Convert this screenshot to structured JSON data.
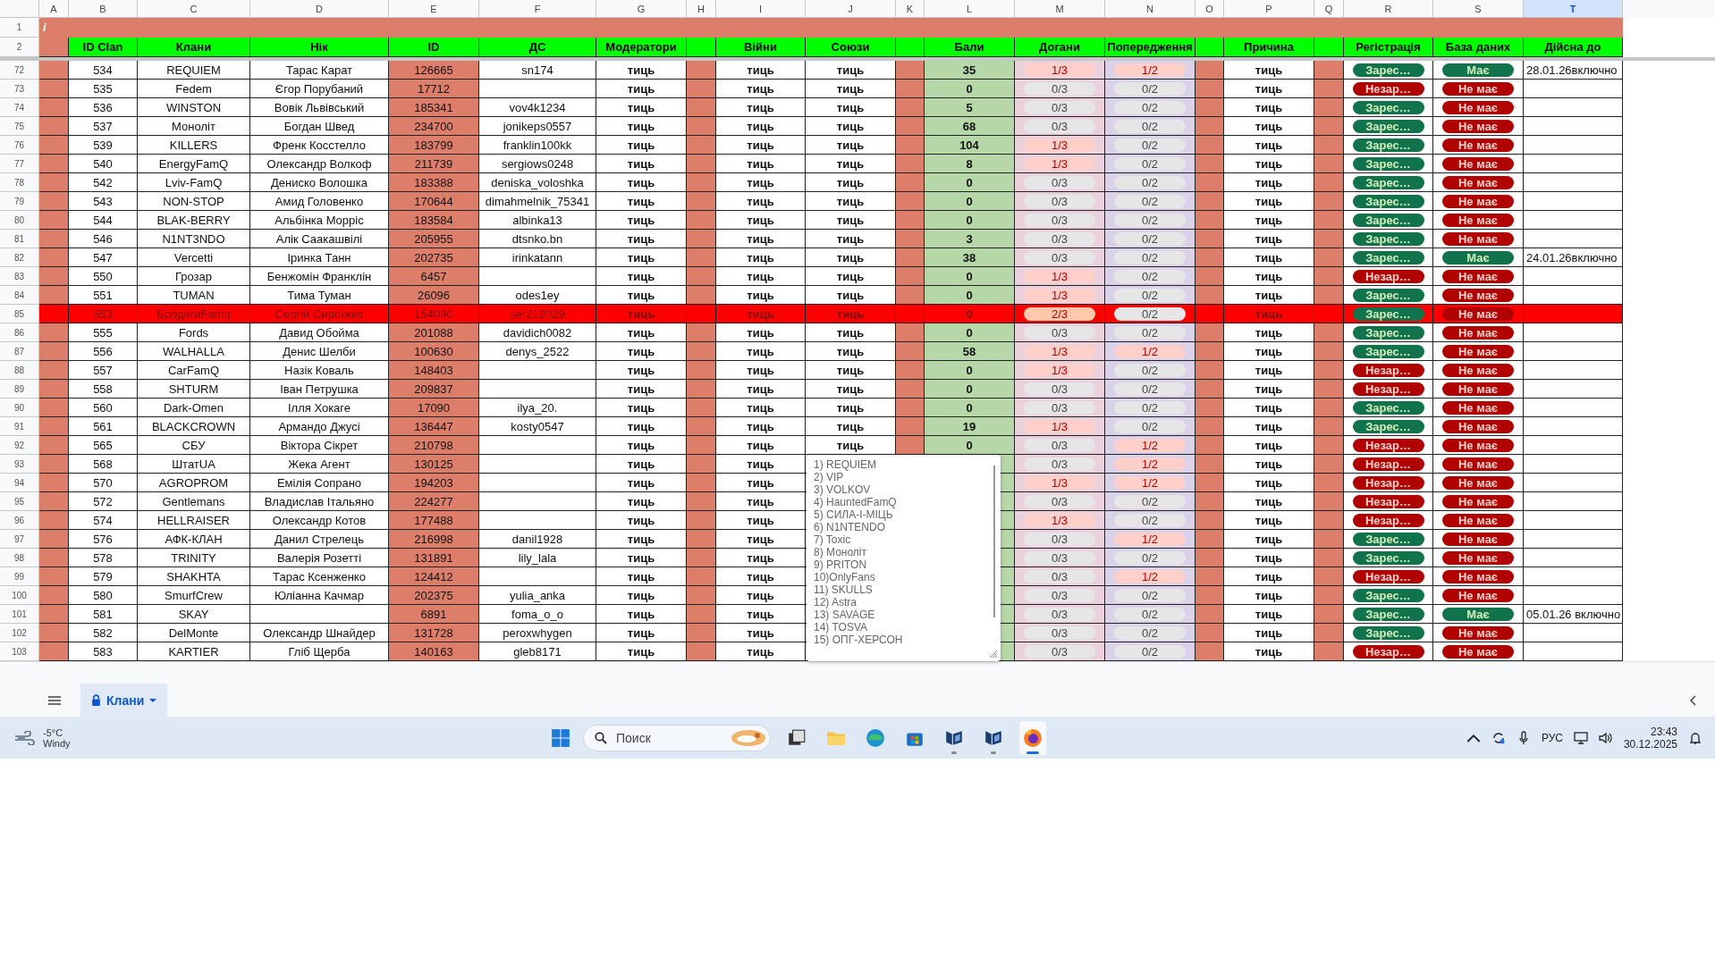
{
  "sheet": {
    "columns": [
      {
        "letter": "A",
        "selected": false
      },
      {
        "letter": "B",
        "heading": "ID Clan",
        "selected": false
      },
      {
        "letter": "C",
        "heading": "Клани",
        "selected": false
      },
      {
        "letter": "D",
        "heading": "Нік",
        "selected": false
      },
      {
        "letter": "E",
        "heading": "ID",
        "selected": false
      },
      {
        "letter": "F",
        "heading": "ДС",
        "selected": false
      },
      {
        "letter": "G",
        "heading": "Модератори",
        "selected": false
      },
      {
        "letter": "H",
        "selected": false
      },
      {
        "letter": "I",
        "heading": "Війни",
        "selected": false
      },
      {
        "letter": "J",
        "heading": "Союзи",
        "selected": false
      },
      {
        "letter": "K",
        "selected": false
      },
      {
        "letter": "L",
        "heading": "Бали",
        "selected": false
      },
      {
        "letter": "M",
        "heading": "Догани",
        "selected": false
      },
      {
        "letter": "N",
        "heading": "Попередження",
        "selected": false
      },
      {
        "letter": "O",
        "selected": false
      },
      {
        "letter": "P",
        "heading": "Причина",
        "selected": false
      },
      {
        "letter": "Q",
        "selected": false
      },
      {
        "letter": "R",
        "heading": "Регістрація",
        "selected": false
      },
      {
        "letter": "S",
        "heading": "База даних",
        "selected": false
      },
      {
        "letter": "T",
        "heading": "Дійсна до",
        "selected": true
      }
    ],
    "header_rows": [
      {
        "num": "1",
        "note_mark": "i"
      },
      {
        "num": "2"
      }
    ],
    "rows": [
      {
        "num": "72",
        "id_clan": "534",
        "clan": "REQUIEM",
        "nick": "Тарас Карат",
        "id": "126665",
        "ds": "sn174",
        "moderators": "тиць",
        "wars": "тиць",
        "alliances": "тиць",
        "points": "35",
        "reprimands": {
          "text": "1/3",
          "flagged": true,
          "severe": false
        },
        "warnings": {
          "text": "1/2",
          "flagged": true,
          "severe": false
        },
        "reason": "тиць",
        "registration": {
          "text": "Зарес…",
          "registered": true
        },
        "database": {
          "text": "Має",
          "has": true
        },
        "valid_until": "28.01.26включно",
        "highlighted": false
      },
      {
        "num": "73",
        "id_clan": "535",
        "clan": "Fedem",
        "nick": "Єгор Порубаний",
        "id": "17712",
        "moderators": "тиць",
        "wars": "тиць",
        "alliances": "тиць",
        "points": "0",
        "reprimands": {
          "text": "0/3",
          "flagged": false,
          "severe": false
        },
        "warnings": {
          "text": "0/2",
          "flagged": false,
          "severe": false
        },
        "reason": "тиць",
        "registration": {
          "text": "Незар…",
          "registered": false
        },
        "database": {
          "text": "Не має",
          "has": false
        },
        "highlighted": false
      },
      {
        "num": "74",
        "id_clan": "536",
        "clan": "WINSTON",
        "nick": "Вовік Львівський",
        "id": "185341",
        "ds": "vov4k1234",
        "moderators": "тиць",
        "wars": "тиць",
        "alliances": "тиць",
        "points": "5",
        "reprimands": {
          "text": "0/3",
          "flagged": false,
          "severe": false
        },
        "warnings": {
          "text": "0/2",
          "flagged": false,
          "severe": false
        },
        "reason": "тиць",
        "registration": {
          "text": "Зарес…",
          "registered": true
        },
        "database": {
          "text": "Не має",
          "has": false
        },
        "highlighted": false
      },
      {
        "num": "75",
        "id_clan": "537",
        "clan": "Моноліт",
        "nick": "Богдан Швед",
        "id": "234700",
        "ds": "jonikeps0557",
        "moderators": "тиць",
        "wars": "тиць",
        "alliances": "тиць",
        "points": "68",
        "reprimands": {
          "text": "0/3",
          "flagged": false,
          "severe": false
        },
        "warnings": {
          "text": "0/2",
          "flagged": false,
          "severe": false
        },
        "reason": "тиць",
        "registration": {
          "text": "Зарес…",
          "registered": true
        },
        "database": {
          "text": "Не має",
          "has": false
        },
        "highlighted": false
      },
      {
        "num": "76",
        "id_clan": "539",
        "clan": "KILLERS",
        "nick": "Френк Косстелло",
        "id": "183799",
        "ds": "franklin100kk",
        "moderators": "тиць",
        "wars": "тиць",
        "alliances": "тиць",
        "points": "104",
        "reprimands": {
          "text": "1/3",
          "flagged": true,
          "severe": false
        },
        "warnings": {
          "text": "0/2",
          "flagged": false,
          "severe": false
        },
        "reason": "тиць",
        "registration": {
          "text": "Зарес…",
          "registered": true
        },
        "database": {
          "text": "Не має",
          "has": false
        },
        "highlighted": false
      },
      {
        "num": "77",
        "id_clan": "540",
        "clan": "EnergyFamQ",
        "nick": "Олександр Волкоф",
        "id": "211739",
        "ds": "sergiows0248",
        "moderators": "тиць",
        "wars": "тиць",
        "alliances": "тиць",
        "points": "8",
        "reprimands": {
          "text": "1/3",
          "flagged": true,
          "severe": false
        },
        "warnings": {
          "text": "0/2",
          "flagged": false,
          "severe": false
        },
        "reason": "тиць",
        "registration": {
          "text": "Зарес…",
          "registered": true
        },
        "database": {
          "text": "Не має",
          "has": false
        },
        "highlighted": false
      },
      {
        "num": "78",
        "id_clan": "542",
        "clan": "Lviv-FamQ",
        "nick": "Дениско Волошка",
        "id": "183388",
        "ds": "deniska_voloshka",
        "moderators": "тиць",
        "wars": "тиць",
        "alliances": "тиць",
        "points": "0",
        "reprimands": {
          "text": "0/3",
          "flagged": false,
          "severe": false
        },
        "warnings": {
          "text": "0/2",
          "flagged": false,
          "severe": false
        },
        "reason": "тиць",
        "registration": {
          "text": "Зарес…",
          "registered": true
        },
        "database": {
          "text": "Не має",
          "has": false
        },
        "highlighted": false
      },
      {
        "num": "79",
        "id_clan": "543",
        "clan": "NON-STOP",
        "nick": "Амид Головенко",
        "id": "170644",
        "ds": "dimahmelnik_75341",
        "moderators": "тиць",
        "wars": "тиць",
        "alliances": "тиць",
        "points": "0",
        "reprimands": {
          "text": "0/3",
          "flagged": false,
          "severe": false
        },
        "warnings": {
          "text": "0/2",
          "flagged": false,
          "severe": false
        },
        "reason": "тиць",
        "registration": {
          "text": "Зарес…",
          "registered": true
        },
        "database": {
          "text": "Не має",
          "has": false
        },
        "highlighted": false
      },
      {
        "num": "80",
        "id_clan": "544",
        "clan": "BLAK-BERRY",
        "nick": "Альбінка Морріс",
        "id": "183584",
        "ds": "albinka13",
        "moderators": "тиць",
        "wars": "тиць",
        "alliances": "тиць",
        "points": "0",
        "reprimands": {
          "text": "0/3",
          "flagged": false,
          "severe": false
        },
        "warnings": {
          "text": "0/2",
          "flagged": false,
          "severe": false
        },
        "reason": "тиць",
        "registration": {
          "text": "Зарес…",
          "registered": true
        },
        "database": {
          "text": "Не має",
          "has": false
        },
        "highlighted": false
      },
      {
        "num": "81",
        "id_clan": "546",
        "clan": "N1NT3NDO",
        "nick": "Алік Саакашвілі",
        "id": "205955",
        "ds": "dtsnko.bn",
        "moderators": "тиць",
        "wars": "тиць",
        "alliances": "тиць",
        "points": "3",
        "reprimands": {
          "text": "0/3",
          "flagged": false,
          "severe": false
        },
        "warnings": {
          "text": "0/2",
          "flagged": false,
          "severe": false
        },
        "reason": "тиць",
        "registration": {
          "text": "Зарес…",
          "registered": true
        },
        "database": {
          "text": "Не має",
          "has": false
        },
        "highlighted": false
      },
      {
        "num": "82",
        "id_clan": "547",
        "clan": "Vercetti",
        "nick": "Іринка Танн",
        "id": "202735",
        "ds": "irinkatann",
        "moderators": "тиць",
        "wars": "тиць",
        "alliances": "тиць",
        "points": "38",
        "reprimands": {
          "text": "0/3",
          "flagged": false,
          "severe": false
        },
        "warnings": {
          "text": "0/2",
          "flagged": false,
          "severe": false
        },
        "reason": "тиць",
        "registration": {
          "text": "Зарес…",
          "registered": true
        },
        "database": {
          "text": "Має",
          "has": true
        },
        "valid_until": "24.01.26включно",
        "highlighted": false
      },
      {
        "num": "83",
        "id_clan": "550",
        "clan": "Грозар",
        "nick": "Бенжомін Франклін",
        "id": "6457",
        "moderators": "тиць",
        "wars": "тиць",
        "alliances": "тиць",
        "points": "0",
        "reprimands": {
          "text": "1/3",
          "flagged": true,
          "severe": false
        },
        "warnings": {
          "text": "0/2",
          "flagged": false,
          "severe": false
        },
        "reason": "тиць",
        "registration": {
          "text": "Незар…",
          "registered": false
        },
        "database": {
          "text": "Не має",
          "has": false
        },
        "highlighted": false
      },
      {
        "num": "84",
        "id_clan": "551",
        "clan": "TUMAN",
        "nick": "Тима Туман",
        "id": "26096",
        "ds": "odes1ey",
        "moderators": "тиць",
        "wars": "тиць",
        "alliances": "тиць",
        "points": "0",
        "reprimands": {
          "text": "1/3",
          "flagged": true,
          "severe": false
        },
        "warnings": {
          "text": "0/2",
          "flagged": false,
          "severe": false
        },
        "reason": "тиць",
        "registration": {
          "text": "Зарес…",
          "registered": true
        },
        "database": {
          "text": "Не має",
          "has": false
        },
        "highlighted": false
      },
      {
        "num": "85",
        "id_clan": "553",
        "clan": "БродягиFamq",
        "nick": "Сергій Сироїжко",
        "id": "154090",
        "ds": "ser212029",
        "moderators": "тиць",
        "wars": "тиць",
        "alliances": "тиць",
        "points": "0",
        "reprimands": {
          "text": "2/3",
          "flagged": true,
          "severe": true
        },
        "warnings": {
          "text": "0/2",
          "flagged": false,
          "severe": false
        },
        "reason": "тиць",
        "registration": {
          "text": "Зарес…",
          "registered": true
        },
        "database": {
          "text": "Не має",
          "has": false
        },
        "highlighted": true
      },
      {
        "num": "86",
        "id_clan": "555",
        "clan": "Fords",
        "nick": "Давид Обойма",
        "id": "201088",
        "ds": "davidich0082",
        "moderators": "тиць",
        "wars": "тиць",
        "alliances": "тиць",
        "points": "0",
        "reprimands": {
          "text": "0/3",
          "flagged": false,
          "severe": false
        },
        "warnings": {
          "text": "0/2",
          "flagged": false,
          "severe": false
        },
        "reason": "тиць",
        "registration": {
          "text": "Зарес…",
          "registered": true
        },
        "database": {
          "text": "Не має",
          "has": false
        },
        "highlighted": false
      },
      {
        "num": "87",
        "id_clan": "556",
        "clan": "WALHALLA",
        "nick": "Денис Шелби",
        "id": "100630",
        "ds": "denys_2522",
        "moderators": "тиць",
        "wars": "тиць",
        "alliances": "тиць",
        "points": "58",
        "reprimands": {
          "text": "1/3",
          "flagged": true,
          "severe": false
        },
        "warnings": {
          "text": "1/2",
          "flagged": true,
          "severe": false
        },
        "reason": "тиць",
        "registration": {
          "text": "Зарес…",
          "registered": true
        },
        "database": {
          "text": "Не має",
          "has": false
        },
        "highlighted": false
      },
      {
        "num": "88",
        "id_clan": "557",
        "clan": "CarFamQ",
        "nick": "Назік Коваль",
        "id": "148403",
        "moderators": "тиць",
        "wars": "тиць",
        "alliances": "тиць",
        "points": "0",
        "reprimands": {
          "text": "1/3",
          "flagged": true,
          "severe": false
        },
        "warnings": {
          "text": "0/2",
          "flagged": false,
          "severe": false
        },
        "reason": "тиць",
        "registration": {
          "text": "Незар…",
          "registered": false
        },
        "database": {
          "text": "Не має",
          "has": false
        },
        "highlighted": false
      },
      {
        "num": "89",
        "id_clan": "558",
        "clan": "SHTURM",
        "nick": "Іван Петрушка",
        "id": "209837",
        "moderators": "тиць",
        "wars": "тиць",
        "alliances": "тиць",
        "points": "0",
        "reprimands": {
          "text": "0/3",
          "flagged": false,
          "severe": false
        },
        "warnings": {
          "text": "0/2",
          "flagged": false,
          "severe": false
        },
        "reason": "тиць",
        "registration": {
          "text": "Незар…",
          "registered": false
        },
        "database": {
          "text": "Не має",
          "has": false
        },
        "highlighted": false
      },
      {
        "num": "90",
        "id_clan": "560",
        "clan": "Dark-Omen",
        "nick": "Ілля Хокаге",
        "id": "17090",
        "ds": "ilya_20.",
        "moderators": "тиць",
        "wars": "тиць",
        "alliances": "тиць",
        "points": "0",
        "reprimands": {
          "text": "0/3",
          "flagged": false,
          "severe": false
        },
        "warnings": {
          "text": "0/2",
          "flagged": false,
          "severe": false
        },
        "reason": "тиць",
        "registration": {
          "text": "Зарес…",
          "registered": true
        },
        "database": {
          "text": "Не має",
          "has": false
        },
        "highlighted": false
      },
      {
        "num": "91",
        "id_clan": "561",
        "clan": "BLACKCROWN",
        "nick": "Армандо Джусі",
        "id": "136447",
        "ds": "kosty0547",
        "moderators": "тиць",
        "wars": "тиць",
        "alliances": "тиць",
        "points": "19",
        "reprimands": {
          "text": "1/3",
          "flagged": true,
          "severe": false
        },
        "warnings": {
          "text": "0/2",
          "flagged": false,
          "severe": false
        },
        "reason": "тиць",
        "registration": {
          "text": "Зарес…",
          "registered": true
        },
        "database": {
          "text": "Не має",
          "has": false
        },
        "highlighted": false
      },
      {
        "num": "92",
        "id_clan": "565",
        "clan": "СБУ",
        "nick": "Віктора Сікрет",
        "id": "210798",
        "moderators": "тиць",
        "wars": "тиць",
        "alliances": "тиць",
        "points": "0",
        "reprimands": {
          "text": "0/3",
          "flagged": false,
          "severe": false
        },
        "warnings": {
          "text": "1/2",
          "flagged": true,
          "severe": false
        },
        "reason": "тиць",
        "registration": {
          "text": "Незар…",
          "registered": false
        },
        "database": {
          "text": "Не має",
          "has": false
        },
        "highlighted": false
      },
      {
        "num": "93",
        "id_clan": "568",
        "clan": "ШтатUA",
        "nick": "Жека Агент",
        "id": "130125",
        "moderators": "тиць",
        "wars": "тиць",
        "reprimands": {
          "text": "0/3",
          "flagged": false,
          "severe": false
        },
        "warnings": {
          "text": "1/2",
          "flagged": true,
          "severe": false
        },
        "reason": "тиць",
        "registration": {
          "text": "Незар…",
          "registered": false
        },
        "database": {
          "text": "Не має",
          "has": false
        },
        "highlighted": false
      },
      {
        "num": "94",
        "id_clan": "570",
        "clan": "AGROPROM",
        "nick": "Емілія Сопрано",
        "id": "194203",
        "moderators": "тиць",
        "wars": "тиць",
        "reprimands": {
          "text": "1/3",
          "flagged": true,
          "severe": false
        },
        "warnings": {
          "text": "1/2",
          "flagged": true,
          "severe": false
        },
        "reason": "тиць",
        "registration": {
          "text": "Незар…",
          "registered": false
        },
        "database": {
          "text": "Не має",
          "has": false
        },
        "highlighted": false
      },
      {
        "num": "95",
        "id_clan": "572",
        "clan": "Gentlemans",
        "nick": "Владислав Італьяно",
        "id": "224277",
        "moderators": "тиць",
        "wars": "тиць",
        "reprimands": {
          "text": "0/3",
          "flagged": false,
          "severe": false
        },
        "warnings": {
          "text": "0/2",
          "flagged": false,
          "severe": false
        },
        "reason": "тиць",
        "registration": {
          "text": "Незар…",
          "registered": false
        },
        "database": {
          "text": "Не має",
          "has": false
        },
        "highlighted": false
      },
      {
        "num": "96",
        "id_clan": "574",
        "clan": "HELLRAISER",
        "nick": "Олександр Котов",
        "id": "177488",
        "moderators": "тиць",
        "wars": "тиць",
        "reprimands": {
          "text": "1/3",
          "flagged": true,
          "severe": false
        },
        "warnings": {
          "text": "0/2",
          "flagged": false,
          "severe": false
        },
        "reason": "тиць",
        "registration": {
          "text": "Незар…",
          "registered": false
        },
        "database": {
          "text": "Не має",
          "has": false
        },
        "highlighted": false
      },
      {
        "num": "97",
        "id_clan": "576",
        "clan": "АФК-КЛАН",
        "nick": "Данил Стрелець",
        "id": "216998",
        "ds": "danil1928",
        "moderators": "тиць",
        "wars": "тиць",
        "reprimands": {
          "text": "0/3",
          "flagged": false,
          "severe": false
        },
        "warnings": {
          "text": "1/2",
          "flagged": true,
          "severe": false
        },
        "reason": "тиць",
        "registration": {
          "text": "Зарес…",
          "registered": true
        },
        "database": {
          "text": "Не має",
          "has": false
        },
        "highlighted": false
      },
      {
        "num": "98",
        "id_clan": "578",
        "clan": "TRINITY",
        "nick": "Валерія Розетті",
        "id": "131891",
        "ds": "lily_lala",
        "moderators": "тиць",
        "wars": "тиць",
        "reprimands": {
          "text": "0/3",
          "flagged": false,
          "severe": false
        },
        "warnings": {
          "text": "0/2",
          "flagged": false,
          "severe": false
        },
        "reason": "тиць",
        "registration": {
          "text": "Зарес…",
          "registered": true
        },
        "database": {
          "text": "Не має",
          "has": false
        },
        "highlighted": false
      },
      {
        "num": "99",
        "id_clan": "579",
        "clan": "SHAKHTA",
        "nick": "Тарас Ксенженко",
        "id": "124412",
        "moderators": "тиць",
        "wars": "тиць",
        "reprimands": {
          "text": "0/3",
          "flagged": false,
          "severe": false
        },
        "warnings": {
          "text": "1/2",
          "flagged": true,
          "severe": false
        },
        "reason": "тиць",
        "registration": {
          "text": "Незар…",
          "registered": false
        },
        "database": {
          "text": "Не має",
          "has": false
        },
        "highlighted": false
      },
      {
        "num": "100",
        "id_clan": "580",
        "clan": "SmurfCrew",
        "nick": "Юліанна Качмар",
        "id": "202375",
        "ds": "yulia_anka",
        "moderators": "тиць",
        "wars": "тиць",
        "reprimands": {
          "text": "0/3",
          "flagged": false,
          "severe": false
        },
        "warnings": {
          "text": "0/2",
          "flagged": false,
          "severe": false
        },
        "reason": "тиць",
        "registration": {
          "text": "Зарес…",
          "registered": true
        },
        "database": {
          "text": "Не має",
          "has": false
        },
        "highlighted": false
      },
      {
        "num": "101",
        "id_clan": "581",
        "clan": "SKAY",
        "id": "6891",
        "ds": "foma_o_o",
        "moderators": "тиць",
        "wars": "тиць",
        "reprimands": {
          "text": "0/3",
          "flagged": false,
          "severe": false
        },
        "warnings": {
          "text": "0/2",
          "flagged": false,
          "severe": false
        },
        "reason": "тиць",
        "registration": {
          "text": "Зарес…",
          "registered": true
        },
        "database": {
          "text": "Має",
          "has": true
        },
        "valid_until": "05.01.26 включно",
        "highlighted": false
      },
      {
        "num": "102",
        "id_clan": "582",
        "clan": "DelMonte",
        "nick": "Олександр Шнайдер",
        "id": "131728",
        "ds": "peroxwhygen",
        "moderators": "тиць",
        "wars": "тиць",
        "reprimands": {
          "text": "0/3",
          "flagged": false,
          "severe": false
        },
        "warnings": {
          "text": "0/2",
          "flagged": false,
          "severe": false
        },
        "reason": "тиць",
        "registration": {
          "text": "Зарес…",
          "registered": true
        },
        "database": {
          "text": "Не має",
          "has": false
        },
        "highlighted": false
      },
      {
        "num": "103",
        "id_clan": "583",
        "clan": "KARTIER",
        "nick": "Гліб Щерба",
        "id": "140163",
        "ds": "gleb8171",
        "moderators": "тиць",
        "wars": "тиць",
        "reprimands": {
          "text": "0/3",
          "flagged": false,
          "severe": false
        },
        "warnings": {
          "text": "0/2",
          "flagged": false,
          "severe": false
        },
        "reason": "тиць",
        "registration": {
          "text": "Незар…",
          "registered": false
        },
        "database": {
          "text": "Не має",
          "has": false
        },
        "highlighted": false
      }
    ],
    "dropdown": {
      "items": [
        "1) REQUIEM",
        "2) VIP",
        "3) VOLKOV",
        "4) HauntedFamQ",
        "5) СИЛА-І-МІЦЬ",
        "6) N1NTENDO",
        "7) Toxic",
        "8) Моноліт",
        "9) PRITON",
        "10)OnlyFans",
        "11) SKULLS",
        "12) Astra",
        "13) SAVAGE",
        "14) TOSVA",
        "15) ОПГ-ХЕРСОН"
      ]
    }
  },
  "sheet_tabs": [
    {
      "label": "Клани",
      "selected": true,
      "locked": true
    }
  ],
  "taskbar": {
    "weather": {
      "temperature": "-5°C",
      "condition": "Windy"
    },
    "search": {
      "placeholder": "Поиск"
    },
    "apps": [
      {
        "kind": "taskview",
        "running": false,
        "active": false
      },
      {
        "kind": "folder",
        "running": false,
        "active": false
      },
      {
        "kind": "edge",
        "running": false,
        "active": false
      },
      {
        "kind": "store",
        "running": false,
        "active": false
      },
      {
        "kind": "game",
        "running": true,
        "active": false
      },
      {
        "kind": "game",
        "running": true,
        "active": false
      },
      {
        "kind": "firefox",
        "running": true,
        "active": true
      }
    ],
    "language": "РУС",
    "time": "23:43",
    "date": "30.12.2025"
  }
}
